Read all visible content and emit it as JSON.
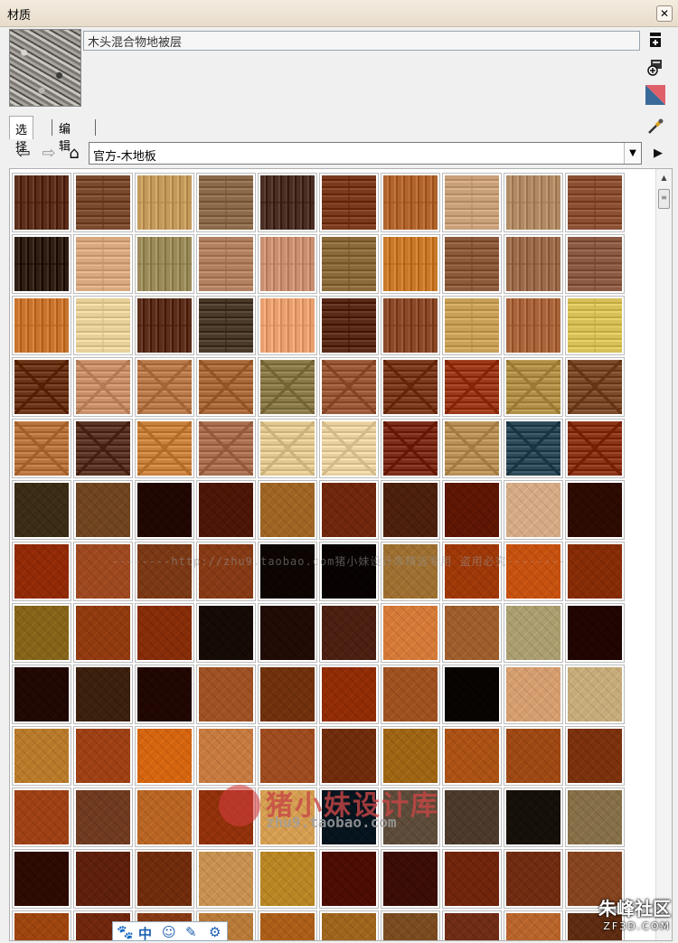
{
  "window": {
    "title": "材质",
    "close_glyph": "✕"
  },
  "material": {
    "name": "木头混合物地被层"
  },
  "side_icons": [
    "new-material-icon",
    "save-material-icon",
    "color-swatch-icon"
  ],
  "tabs": [
    {
      "label": "选择",
      "active": true
    },
    {
      "label": "编辑",
      "active": false
    }
  ],
  "nav": {
    "back_glyph": "⇦",
    "forward_glyph": "⇨",
    "home_glyph": "⌂",
    "library": "官方-木地板",
    "details_glyph": "▶"
  },
  "watermarks": {
    "line": "--------http://zhu9.taobao.com猪小妹设计库精选专用 盗用必究--------",
    "logo_cn": "猪小妹设计库",
    "logo_url": "zhu9.taobao.com",
    "corner_cn": "朱峰社区",
    "corner_en": "ZF3D.COM"
  },
  "ime_bar": [
    "🐾",
    "中",
    "☺",
    "✎",
    "⚙"
  ],
  "swatch_rows": [
    [
      "#5a2e1a",
      "#7a4a2e",
      "#c49a5c",
      "#8a6a4a",
      "#4a2e24",
      "#7a3a1e",
      "#b0642e",
      "#c8a07a",
      "#b08a64",
      "#8a5034"
    ],
    [
      "#2e1e14",
      "#d8a880",
      "#9a8a5a",
      "#b08060",
      "#c89070",
      "#8a6a3a",
      "#c87a2a",
      "#8a5a3a",
      "#9a6a4a",
      "#8a5a44"
    ],
    [
      "#c8742e",
      "#e8d09a",
      "#5a2e1a",
      "#4a3a2a",
      "#e8a070",
      "#5a2a18",
      "#8a4a2a",
      "#c8a058",
      "#a8643a",
      "#d8c058"
    ],
    [
      "#6a3418",
      "#c8906a",
      "#b87a4a",
      "#a86a3a",
      "#8a7a4a",
      "#9a5a3a",
      "#7a3a1e",
      "#9a3a1a",
      "#b09048",
      "#7a4a2a"
    ],
    [
      "#b8743e",
      "#5a3424",
      "#c8823e",
      "#a87050",
      "#e0c890",
      "#e8d0a0",
      "#7a2e1a",
      "#b89058",
      "#2e4a58",
      "#8a3418"
    ],
    [
      "#7a6a4a",
      "#a8845a",
      "#5a2a18",
      "#8a4a2a",
      "#c8a060",
      "#a8643a",
      "#8a5a3a",
      "#9a4a1e",
      "#e8d0b8",
      "#6a3418"
    ],
    [
      "#c0682a",
      "#c8885a",
      "#b0784a",
      "#b87a4a",
      "#3a2418",
      "#2e1c14",
      "#c8a870",
      "#c8782e",
      "#e09040",
      "#b86a2a"
    ],
    [
      "#b8a050",
      "#c07a40",
      "#b86a30",
      "#4a3426",
      "#5a3424",
      "#8a5a44",
      "#e8b078",
      "#c89a6a",
      "#d0c8a8",
      "#5a2418"
    ],
    [
      "#5a2e1a",
      "#7a5a3a",
      "#5a2a18",
      "#c89060",
      "#a8703a",
      "#c06a24",
      "#c8905a",
      "#2e2018",
      "#e8c8a8",
      "#e0d0b0"
    ],
    [
      "#d8b068",
      "#c8804a",
      "#e8a040",
      "#e0b080",
      "#c88a5a",
      "#a86a3a",
      "#c8a048",
      "#d0904a",
      "#c88848",
      "#b0703a"
    ],
    [
      "#c8804a",
      "#a87a5a",
      "#d8a060",
      "#c07038",
      "#e8c890",
      "#284858",
      "#9a8a7a",
      "#8a7a6a",
      "#4a4030",
      "#b8a888"
    ],
    [
      "#6a3418",
      "#9a5a3a",
      "#a86a3a",
      "#e0c090",
      "#d8b860",
      "#8a3a1e",
      "#7a3a28",
      "#a86038",
      "#a86a44",
      "#b8845a"
    ],
    [
      "#c8843e",
      "#a8643a",
      "#b87a4a",
      "#d8b078",
      "#d09a50",
      "#c8a058",
      "#b08a5a",
      "#a86a4a",
      "#d8a06a",
      "#9a6a44"
    ]
  ]
}
